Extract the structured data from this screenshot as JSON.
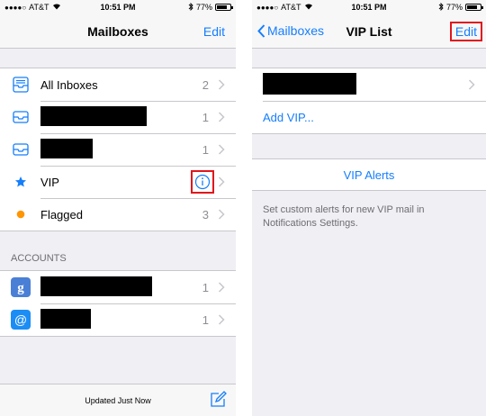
{
  "status_left": {
    "carrier": "AT&T",
    "time": "10:51 PM",
    "battery": "77%",
    "battery_fraction": 0.77
  },
  "status_right": {
    "carrier": "AT&T",
    "time": "10:51 PM",
    "battery": "77%",
    "battery_fraction": 0.77
  },
  "mailboxes": {
    "title": "Mailboxes",
    "edit_label": "Edit",
    "rows": [
      {
        "label": "All Inboxes",
        "count": "2",
        "icon": "inbox-stack-icon"
      },
      {
        "label": "",
        "count": "1",
        "icon": "inbox-icon",
        "redacted": true
      },
      {
        "label": "",
        "count": "1",
        "icon": "inbox-icon",
        "redacted": true
      },
      {
        "label": "VIP",
        "count": "",
        "icon": "star-icon"
      },
      {
        "label": "Flagged",
        "count": "3",
        "icon": "flag-dot-icon"
      }
    ],
    "accounts_header": "ACCOUNTS",
    "accounts": [
      {
        "count": "1",
        "icon": "google-icon",
        "redacted": true
      },
      {
        "count": "1",
        "icon": "at-icon",
        "redacted": true
      }
    ],
    "updated": "Updated Just Now"
  },
  "vip_list": {
    "back_label": "Mailboxes",
    "title": "VIP List",
    "edit_label": "Edit",
    "add_vip": "Add VIP...",
    "vip_alerts": "VIP Alerts",
    "footnote": "Set custom alerts for new VIP mail in Notifications Settings."
  },
  "colors": {
    "accent": "#157efb",
    "highlight": "#e0161d",
    "flag": "#ff9500"
  }
}
